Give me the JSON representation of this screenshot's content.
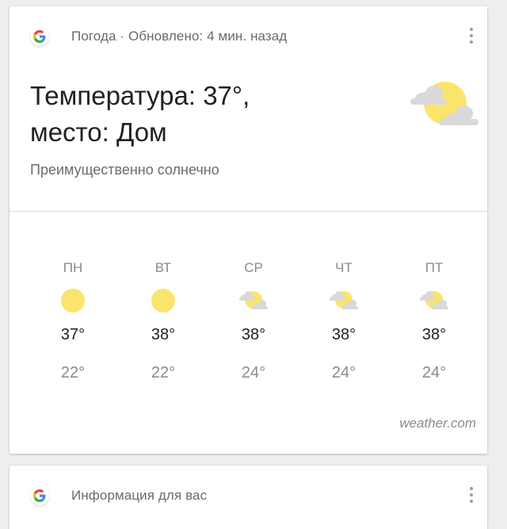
{
  "weather_card": {
    "header": "Погода · Обновлено: 4 мин. назад",
    "title_line1": "Температура: 37°,",
    "title_line2": "место: Дом",
    "condition": "Преимущественно солнечно",
    "current_icon": "partly-sunny-icon",
    "forecast": [
      {
        "day": "ПН",
        "icon": "sun-icon",
        "high": "37°",
        "low": "22°"
      },
      {
        "day": "ВТ",
        "icon": "sun-icon",
        "high": "38°",
        "low": "22°"
      },
      {
        "day": "СР",
        "icon": "partly-sunny-icon",
        "high": "38°",
        "low": "24°"
      },
      {
        "day": "ЧТ",
        "icon": "partly-sunny-icon",
        "high": "38°",
        "low": "24°"
      },
      {
        "day": "ПТ",
        "icon": "partly-sunny-icon",
        "high": "38°",
        "low": "24°"
      }
    ],
    "source": "weather.com"
  },
  "info_card": {
    "header": "Информация для вас"
  },
  "colors": {
    "sun": "#fbe46b",
    "cloud": "#d9d9d9",
    "google_blue": "#4285f4",
    "google_red": "#ea4335",
    "google_yellow": "#fbbc05",
    "google_green": "#34a853"
  }
}
